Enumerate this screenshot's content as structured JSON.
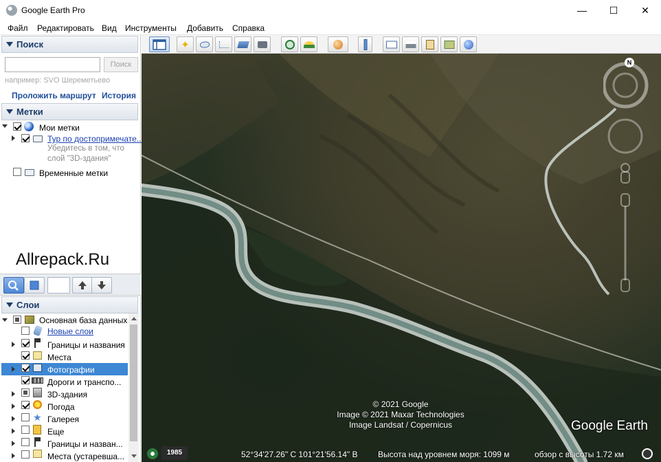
{
  "window": {
    "title": "Google Earth Pro",
    "minimize": "—",
    "maximize": "☐",
    "close": "✕"
  },
  "menu": [
    "Файл",
    "Редактировать",
    "Вид",
    "Инструменты",
    "Добавить",
    "Справка"
  ],
  "search": {
    "header": "Поиск",
    "placeholder": "",
    "button": "Поиск",
    "hint": "например: SVO Шереметьево",
    "route_link": "Проложить маршрут",
    "history_link": "История"
  },
  "places": {
    "header": "Метки",
    "items": [
      {
        "label": "Мои метки",
        "checked": true
      },
      {
        "label": "Тур по достопримечате...",
        "checked": true,
        "note1": "Убедитесь в том, что",
        "note2": "слой \"3D-здания\""
      },
      {
        "label": "Временные метки",
        "checked": false
      }
    ]
  },
  "watermark": "Allrepack.Ru",
  "layers": {
    "header": "Слои",
    "items": [
      {
        "label": "Основная база данных",
        "state": "partial"
      },
      {
        "label": "Новые слои",
        "state": "off",
        "link": true
      },
      {
        "label": "Границы и названия",
        "state": "on"
      },
      {
        "label": "Места",
        "state": "on"
      },
      {
        "label": "Фотографии",
        "state": "on",
        "selected": true
      },
      {
        "label": "Дороги и транспо...",
        "state": "on"
      },
      {
        "label": "3D-здания",
        "state": "partial"
      },
      {
        "label": "Погода",
        "state": "on"
      },
      {
        "label": "Галерея",
        "state": "off"
      },
      {
        "label": "Еще",
        "state": "off"
      },
      {
        "label": "Границы и назван...",
        "state": "off"
      },
      {
        "label": "Места (устаревша...",
        "state": "off"
      }
    ]
  },
  "map": {
    "credit_line1": "© 2021 Google",
    "credit_line2": "Image © 2021 Maxar Technologies",
    "credit_line3": "Image Landsat / Copernicus",
    "logo": "Google Earth",
    "compass_north": "N"
  },
  "status": {
    "year": "1985",
    "coords": "52°34'27.26\" С  101°21'56.14\" В",
    "elevation": "Высота над уровнем моря:  1099 м",
    "eye_alt": "обзор с высоты  1.72 км"
  }
}
